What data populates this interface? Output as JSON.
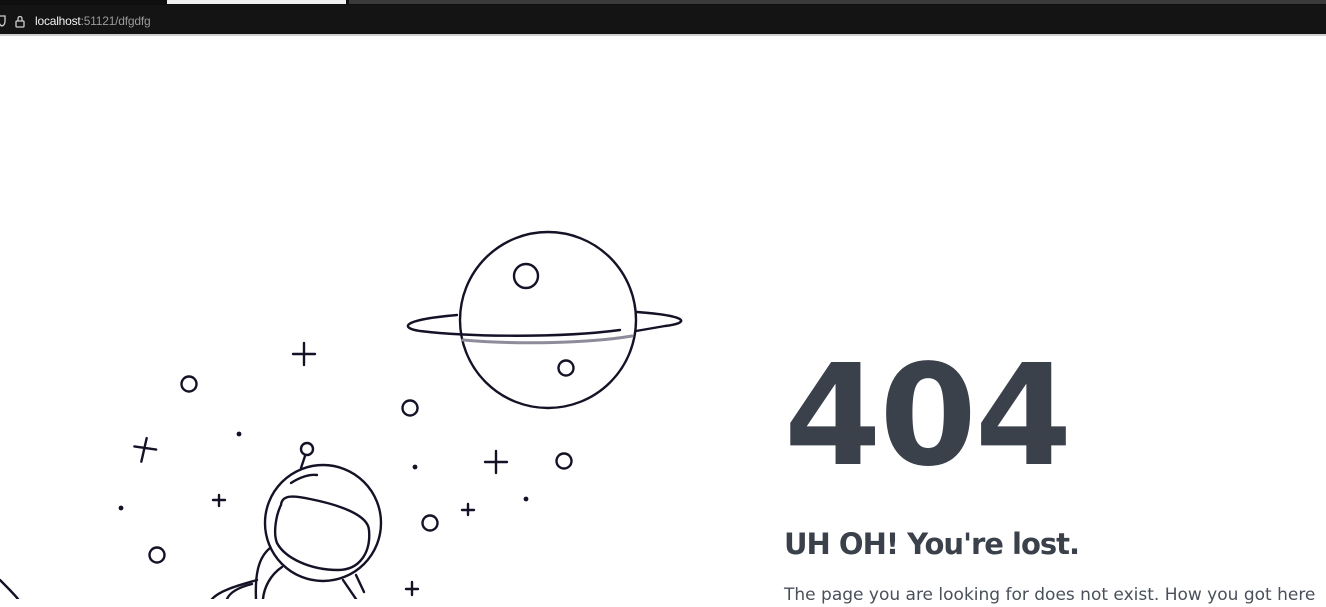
{
  "browser": {
    "url_host": "localhost",
    "url_rest": ":51121/dfgdfg"
  },
  "error": {
    "code": "404",
    "heading": "UH OH! You're lost.",
    "message": "The page you are looking for does not exist. How you got here"
  },
  "colors": {
    "text": "#3b414b",
    "line_art": "#141226",
    "ring_highlight": "#8e8b9a"
  },
  "icons": [
    "shield-icon",
    "lock-icon",
    "planet-icon",
    "astronaut-icon",
    "star-icon"
  ]
}
